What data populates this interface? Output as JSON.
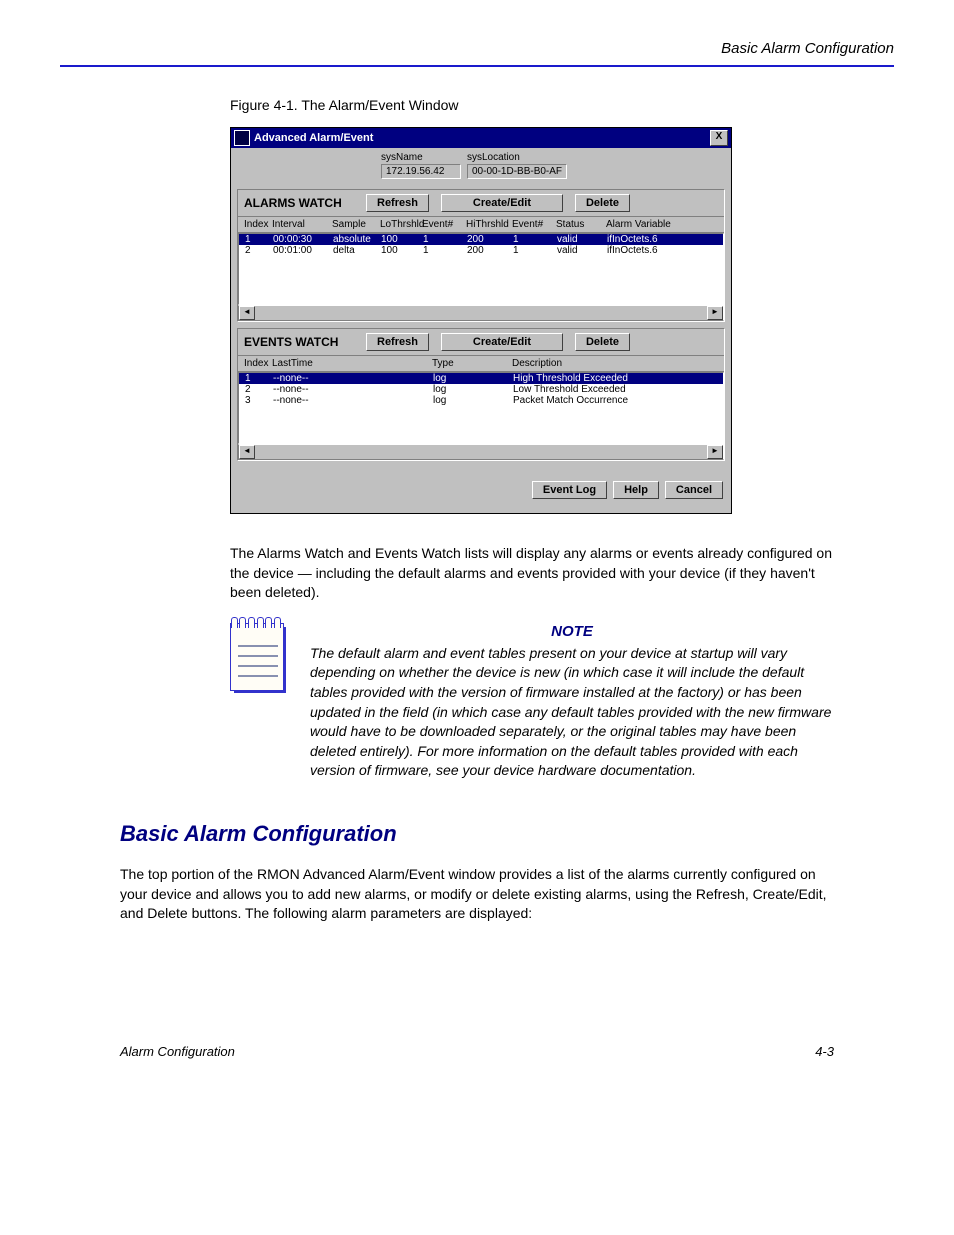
{
  "header_right": "Basic Alarm Configuration",
  "figure_caption": "Figure 4-1. The Alarm/Event Window",
  "dialog": {
    "title": "Advanced Alarm/Event",
    "close": "X",
    "sys": {
      "name_label": "sysName",
      "name_value": "172.19.56.42",
      "loc_label": "sysLocation",
      "loc_value": "00-00-1D-BB-B0-AF"
    },
    "alarms": {
      "title": "ALARMS WATCH",
      "refresh": "Refresh",
      "create": "Create/Edit",
      "delete": "Delete",
      "cols": {
        "idx": "Index",
        "int": "Interval",
        "smp": "Sample",
        "lo": "LoThrshld",
        "ev1": "Event#",
        "hi": "HiThrshld",
        "ev2": "Event#",
        "st": "Status",
        "var": "Alarm Variable"
      },
      "rows": [
        {
          "idx": "1",
          "int": "00:00:30",
          "smp": "absolute",
          "lo": "100",
          "ev1": "1",
          "hi": "200",
          "ev2": "1",
          "st": "valid",
          "var": "ifInOctets.6",
          "sel": true
        },
        {
          "idx": "2",
          "int": "00:01:00",
          "smp": "delta",
          "lo": "100",
          "ev1": "1",
          "hi": "200",
          "ev2": "1",
          "st": "valid",
          "var": "ifInOctets.6",
          "sel": false
        }
      ]
    },
    "events": {
      "title": "EVENTS WATCH",
      "refresh": "Refresh",
      "create": "Create/Edit",
      "delete": "Delete",
      "cols": {
        "idx": "Index",
        "lt": "LastTime",
        "ty": "Type",
        "de": "Description"
      },
      "rows": [
        {
          "idx": "1",
          "lt": "--none--",
          "ty": "log",
          "de": "High Threshold Exceeded",
          "sel": true
        },
        {
          "idx": "2",
          "lt": "--none--",
          "ty": "log",
          "de": "Low Threshold Exceeded",
          "sel": false
        },
        {
          "idx": "3",
          "lt": "--none--",
          "ty": "log",
          "de": "Packet Match Occurrence",
          "sel": false
        }
      ]
    },
    "bottom": {
      "eventlog": "Event Log",
      "help": "Help",
      "cancel": "Cancel"
    }
  },
  "para1": "The Alarms Watch and Events Watch lists will display any alarms or events already configured on the device — including the default alarms and events provided with your device (if they haven't been deleted).",
  "note": {
    "label": "NOTE",
    "body": "The default alarm and event tables present on your device at startup will vary depending on whether the device is new (in which case it will include the default tables provided with the version of firmware installed at the factory) or has been updated in the field (in which case any default tables provided with the new firmware would have to be downloaded separately, or the original tables may have been deleted entirely). For more information on the default tables provided with each version of firmware, see your device hardware documentation."
  },
  "sec_heading": "Basic Alarm Configuration",
  "para2": "The top portion of the RMON Advanced Alarm/Event window provides a list of the alarms currently configured on your device and allows you to add new alarms, or modify or delete existing alarms, using the Refresh, Create/Edit, and Delete buttons. The following alarm parameters are displayed:",
  "footer": {
    "left": "Alarm Configuration",
    "right": "4-3"
  }
}
